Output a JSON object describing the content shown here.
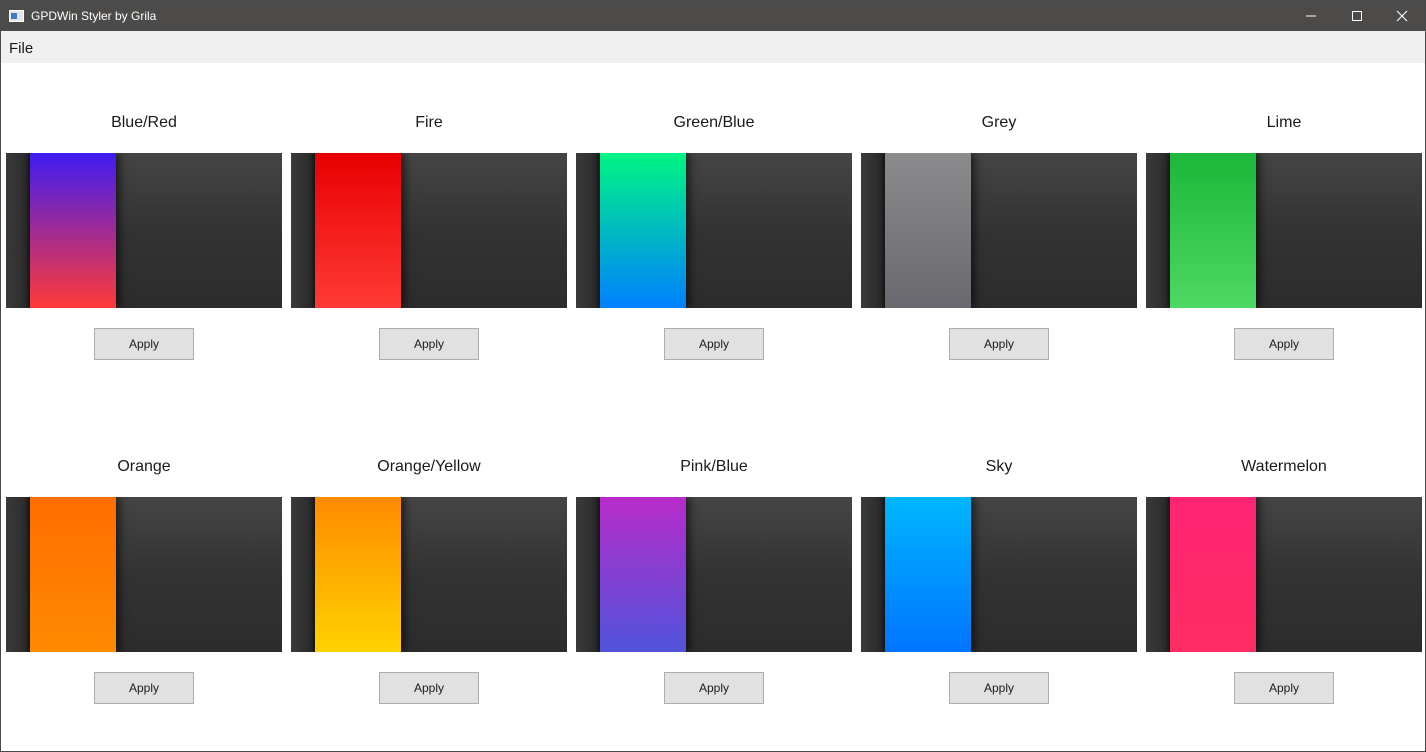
{
  "window": {
    "title": "GPDWin Styler by Grila",
    "minimize_glyph": "—",
    "maximize_glyph": "☐",
    "close_glyph": "✕"
  },
  "menu": {
    "file_label": "File"
  },
  "apply_label": "Apply",
  "themes": [
    {
      "name": "Blue/Red",
      "colors": [
        "#3f1cf2",
        "#ff3a37"
      ]
    },
    {
      "name": "Fire",
      "colors": [
        "#e80000",
        "#ff3a37"
      ]
    },
    {
      "name": "Green/Blue",
      "colors": [
        "#00f583",
        "#0080ff"
      ]
    },
    {
      "name": "Grey",
      "colors": [
        "#8c8b8d",
        "#69686e"
      ]
    },
    {
      "name": "Lime",
      "colors": [
        "#1cb739",
        "#4ed863"
      ]
    },
    {
      "name": "Orange",
      "colors": [
        "#ff6d00",
        "#ff8a00"
      ]
    },
    {
      "name": "Orange/Yellow",
      "colors": [
        "#ff8a00",
        "#ffd200"
      ]
    },
    {
      "name": "Pink/Blue",
      "colors": [
        "#b82bc9",
        "#5054db"
      ]
    },
    {
      "name": "Sky",
      "colors": [
        "#00b6ff",
        "#0074ff"
      ]
    },
    {
      "name": "Watermelon",
      "colors": [
        "#ff2374",
        "#ff2d63"
      ]
    }
  ]
}
